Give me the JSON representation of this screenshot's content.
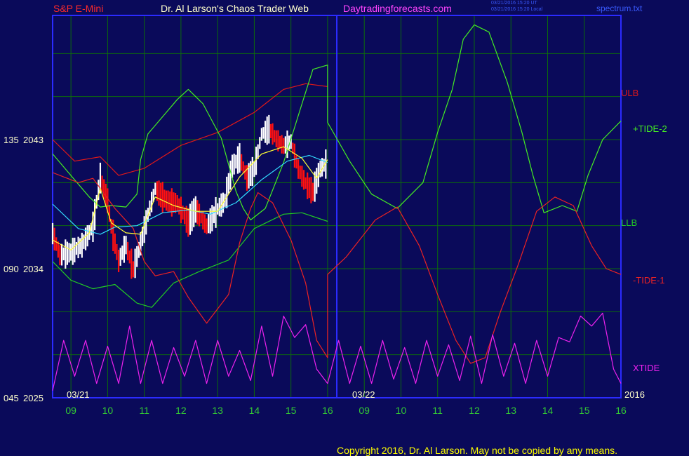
{
  "header": {
    "symbol": "S&P E-Mini",
    "site_title": "Dr. Al Larson's Chaos Trader Web",
    "website": "Daytradingforecasts.com",
    "timestamp_ut": "03/21/2016 15:20 UT",
    "timestamp_local": "03/21/2016 15:20 Local",
    "file": "spectrum.txt"
  },
  "footer": {
    "copyright": "Copyright 2016, Dr. Al Larson. May not be copied by any means."
  },
  "colors": {
    "background": "#0a0a5a",
    "grid": "#0c6b0c",
    "frame": "#2b2bff",
    "price_up": "#ffffff",
    "price_down": "#ff1010",
    "ulb": "#e01818",
    "llb": "#22cc22",
    "tide_plus": "#44ee22",
    "tide_minus": "#ee2222",
    "xtide": "#ee22ee",
    "avg_fast": "#ffff33",
    "avg_slow": "#33ddff",
    "axis_days": "#33cc33",
    "label_cream": "#ffffcc"
  },
  "chart_data": {
    "type": "line",
    "date_labels": [
      "03/21",
      "03/22"
    ],
    "year_label": "2016",
    "x_ticks": [
      "09",
      "10",
      "11",
      "12",
      "13",
      "14",
      "15",
      "16",
      "09",
      "10",
      "11",
      "12",
      "13",
      "14",
      "15",
      "16"
    ],
    "y_ticks": [
      {
        "cycle": "135",
        "price": "2043",
        "value": 2043
      },
      {
        "cycle": "090",
        "price": "2034",
        "value": 2034
      },
      {
        "cycle": "045",
        "price": "2025",
        "value": 2025
      }
    ],
    "ylim": [
      2025,
      2043
    ],
    "series_labels": {
      "ulb": "ULB",
      "llb": "LLB",
      "tide_plus": "+TIDE-2",
      "tide_minus": "-TIDE-1",
      "xtide": "XTIDE"
    },
    "series": [
      {
        "name": "ULB",
        "color": "#e01818",
        "points": [
          [
            8.5,
            2043
          ],
          [
            9.1,
            2041.5
          ],
          [
            9.8,
            2041.8
          ],
          [
            10.3,
            2040.5
          ],
          [
            11.0,
            2041.0
          ],
          [
            12.0,
            2042.6
          ],
          [
            13.0,
            2043.5
          ],
          [
            14.0,
            2044.9
          ],
          [
            14.8,
            2046.5
          ],
          [
            15.4,
            2046.9
          ],
          [
            16.0,
            2046.7
          ]
        ]
      },
      {
        "name": "LLB",
        "color": "#22cc22",
        "points": [
          [
            8.5,
            2034.5
          ],
          [
            9.0,
            2033.2
          ],
          [
            9.6,
            2032.6
          ],
          [
            10.2,
            2032.9
          ],
          [
            10.8,
            2031.6
          ],
          [
            11.2,
            2031.3
          ],
          [
            11.8,
            2033.0
          ],
          [
            12.5,
            2033.8
          ],
          [
            13.3,
            2034.6
          ],
          [
            14.0,
            2036.8
          ],
          [
            14.8,
            2037.8
          ],
          [
            15.3,
            2037.9
          ],
          [
            16.0,
            2037.3
          ]
        ]
      },
      {
        "name": "+TIDE-2",
        "color": "#44ee22",
        "points": [
          [
            8.5,
            2042.0
          ],
          [
            9.0,
            2040.5
          ],
          [
            9.5,
            2039.0
          ],
          [
            9.8,
            2038.3
          ],
          [
            10.1,
            2038.4
          ],
          [
            10.5,
            2038.3
          ],
          [
            10.8,
            2039.2
          ],
          [
            10.9,
            2041.6
          ],
          [
            11.1,
            2043.4
          ],
          [
            11.3,
            2044.0
          ],
          [
            11.9,
            2045.8
          ],
          [
            12.2,
            2046.5
          ],
          [
            12.6,
            2045.5
          ],
          [
            13.1,
            2043.1
          ],
          [
            13.5,
            2039.4
          ],
          [
            13.7,
            2038.2
          ],
          [
            13.9,
            2037.4
          ],
          [
            14.3,
            2038.2
          ],
          [
            14.8,
            2041.4
          ],
          [
            15.3,
            2045.5
          ],
          [
            15.6,
            2047.9
          ],
          [
            16.0,
            2048.2
          ],
          [
            16.0,
            2044.2
          ],
          [
            16.6,
            2041.5
          ],
          [
            17.2,
            2039.2
          ],
          [
            17.9,
            2038.2
          ],
          [
            18.6,
            2040.0
          ],
          [
            19.0,
            2043.5
          ],
          [
            19.4,
            2046.5
          ],
          [
            19.7,
            2050.0
          ],
          [
            20.0,
            2051.0
          ],
          [
            20.4,
            2050.5
          ],
          [
            20.9,
            2047.0
          ],
          [
            21.3,
            2043.5
          ],
          [
            21.6,
            2040.5
          ],
          [
            21.9,
            2037.9
          ],
          [
            22.4,
            2038.4
          ],
          [
            22.8,
            2038.0
          ],
          [
            23.1,
            2040.5
          ],
          [
            23.5,
            2043.0
          ],
          [
            24.0,
            2044.3
          ]
        ]
      },
      {
        "name": "-TIDE-1",
        "color": "#ee2222",
        "points": [
          [
            8.5,
            2040.7
          ],
          [
            9.2,
            2040.0
          ],
          [
            9.6,
            2040.3
          ],
          [
            10.2,
            2038.2
          ],
          [
            10.7,
            2036.8
          ],
          [
            11.0,
            2034.5
          ],
          [
            11.3,
            2033.5
          ],
          [
            11.8,
            2033.8
          ],
          [
            12.2,
            2032.0
          ],
          [
            12.7,
            2030.2
          ],
          [
            13.3,
            2032.2
          ],
          [
            13.6,
            2035.8
          ],
          [
            13.9,
            2038.2
          ],
          [
            14.1,
            2039.3
          ],
          [
            14.5,
            2038.6
          ],
          [
            15.0,
            2036.0
          ],
          [
            15.4,
            2033.0
          ],
          [
            15.7,
            2029.0
          ],
          [
            16.0,
            2027.8
          ],
          [
            16.0,
            2033.6
          ],
          [
            16.5,
            2034.8
          ],
          [
            17.3,
            2037.4
          ],
          [
            17.9,
            2038.3
          ],
          [
            18.5,
            2035.6
          ],
          [
            19.0,
            2032.2
          ],
          [
            19.5,
            2029.0
          ],
          [
            19.9,
            2027.4
          ],
          [
            20.3,
            2027.8
          ],
          [
            20.7,
            2030.9
          ],
          [
            21.2,
            2034.3
          ],
          [
            21.7,
            2038.0
          ],
          [
            22.2,
            2039.0
          ],
          [
            22.7,
            2038.4
          ],
          [
            23.2,
            2035.6
          ],
          [
            23.6,
            2034.0
          ],
          [
            24.0,
            2033.6
          ]
        ]
      },
      {
        "name": "Average (slow)",
        "color": "#33ddff",
        "points": [
          [
            8.5,
            2038.5
          ],
          [
            9.2,
            2036.8
          ],
          [
            9.8,
            2036.4
          ],
          [
            10.2,
            2036.9
          ],
          [
            10.8,
            2037.0
          ],
          [
            11.5,
            2037.9
          ],
          [
            12.2,
            2038.1
          ],
          [
            12.8,
            2037.8
          ],
          [
            13.5,
            2038.6
          ],
          [
            14.2,
            2040.2
          ],
          [
            14.9,
            2041.5
          ],
          [
            15.5,
            2041.9
          ],
          [
            16.0,
            2041.4
          ]
        ]
      },
      {
        "name": "Average (fast)",
        "color": "#ffff33",
        "points": [
          [
            8.5,
            2036.0
          ],
          [
            9.0,
            2035.3
          ],
          [
            9.5,
            2036.5
          ],
          [
            9.8,
            2039.6
          ],
          [
            10.1,
            2037.2
          ],
          [
            10.5,
            2036.5
          ],
          [
            10.9,
            2036.4
          ],
          [
            11.3,
            2039.0
          ],
          [
            11.8,
            2038.4
          ],
          [
            12.4,
            2038.0
          ],
          [
            13.0,
            2038.0
          ],
          [
            13.6,
            2040.4
          ],
          [
            14.2,
            2042.0
          ],
          [
            14.8,
            2042.5
          ],
          [
            15.3,
            2041.7
          ],
          [
            15.7,
            2040.3
          ],
          [
            16.0,
            2041.6
          ]
        ]
      },
      {
        "name": "XTIDE",
        "color": "#ee22ee",
        "points": [
          [
            8.5,
            2025.5
          ],
          [
            8.8,
            2029.0
          ],
          [
            9.1,
            2026.5
          ],
          [
            9.4,
            2029.0
          ],
          [
            9.7,
            2026.0
          ],
          [
            10.0,
            2028.6
          ],
          [
            10.3,
            2026.0
          ],
          [
            10.6,
            2030.0
          ],
          [
            10.9,
            2026.0
          ],
          [
            11.2,
            2029.0
          ],
          [
            11.5,
            2026.0
          ],
          [
            11.8,
            2028.5
          ],
          [
            12.1,
            2026.5
          ],
          [
            12.4,
            2029.0
          ],
          [
            12.7,
            2026.0
          ],
          [
            13.0,
            2029.0
          ],
          [
            13.3,
            2026.5
          ],
          [
            13.6,
            2028.3
          ],
          [
            13.9,
            2026.2
          ],
          [
            14.2,
            2030.0
          ],
          [
            14.5,
            2026.5
          ],
          [
            14.8,
            2030.7
          ],
          [
            15.1,
            2029.2
          ],
          [
            15.4,
            2030.1
          ],
          [
            15.7,
            2027.0
          ],
          [
            16.0,
            2026.0
          ],
          [
            16.3,
            2029.0
          ],
          [
            16.6,
            2026.0
          ],
          [
            16.9,
            2028.6
          ],
          [
            17.2,
            2026.0
          ],
          [
            17.5,
            2029.0
          ],
          [
            17.8,
            2026.3
          ],
          [
            18.1,
            2028.5
          ],
          [
            18.4,
            2026.0
          ],
          [
            18.7,
            2029.0
          ],
          [
            19.0,
            2026.5
          ],
          [
            19.3,
            2028.7
          ],
          [
            19.6,
            2026.2
          ],
          [
            19.9,
            2029.3
          ],
          [
            20.2,
            2026.0
          ],
          [
            20.5,
            2029.4
          ],
          [
            20.8,
            2026.5
          ],
          [
            21.1,
            2028.8
          ],
          [
            21.4,
            2026.0
          ],
          [
            21.7,
            2029.0
          ],
          [
            22.0,
            2026.5
          ],
          [
            22.3,
            2029.2
          ],
          [
            22.6,
            2028.9
          ],
          [
            22.9,
            2030.7
          ],
          [
            23.2,
            2030.0
          ],
          [
            23.5,
            2030.9
          ],
          [
            23.8,
            2027.0
          ],
          [
            24.0,
            2026.0
          ]
        ]
      },
      {
        "name": "Price",
        "color": "#ffffff",
        "points": [
          [
            8.5,
            2036.5
          ],
          [
            8.7,
            2035.0
          ],
          [
            9.0,
            2035.2
          ],
          [
            9.3,
            2035.7
          ],
          [
            9.6,
            2037.0
          ],
          [
            9.8,
            2040.4
          ],
          [
            10.0,
            2038.8
          ],
          [
            10.1,
            2037.0
          ],
          [
            10.3,
            2034.6
          ],
          [
            10.5,
            2035.7
          ],
          [
            10.7,
            2034.0
          ],
          [
            10.9,
            2035.8
          ],
          [
            11.1,
            2037.8
          ],
          [
            11.3,
            2039.6
          ],
          [
            11.6,
            2038.8
          ],
          [
            11.9,
            2038.6
          ],
          [
            12.2,
            2037.3
          ],
          [
            12.4,
            2038.2
          ],
          [
            12.7,
            2037.0
          ],
          [
            13.0,
            2038.2
          ],
          [
            13.2,
            2038.8
          ],
          [
            13.4,
            2041.2
          ],
          [
            13.6,
            2041.8
          ],
          [
            13.8,
            2040.4
          ],
          [
            14.0,
            2041.0
          ],
          [
            14.2,
            2043.4
          ],
          [
            14.4,
            2043.8
          ],
          [
            14.6,
            2043.1
          ],
          [
            14.8,
            2042.6
          ],
          [
            15.0,
            2042.9
          ],
          [
            15.2,
            2041.0
          ],
          [
            15.4,
            2040.0
          ],
          [
            15.6,
            2039.4
          ],
          [
            15.8,
            2041.0
          ],
          [
            16.0,
            2041.5
          ]
        ]
      }
    ]
  }
}
